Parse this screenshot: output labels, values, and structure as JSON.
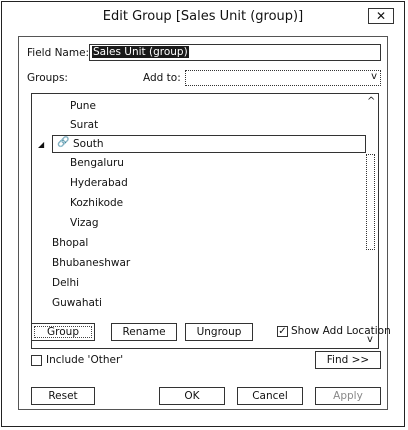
{
  "window": {
    "title": "Edit Group [Sales Unit (group)]",
    "close_glyph": "✕"
  },
  "form": {
    "field_name_label": "Field Name:",
    "field_name_value": "Sales Unit (group)",
    "groups_label": "Groups:",
    "add_to_label": "Add to:",
    "add_to_value": ""
  },
  "tree": {
    "items": [
      {
        "label": "Pune"
      },
      {
        "label": "Surat"
      },
      {
        "label": "South"
      },
      {
        "label": "Bengaluru"
      },
      {
        "label": "Hyderabad"
      },
      {
        "label": "Kozhikode"
      },
      {
        "label": "Vizag"
      },
      {
        "label": "Bhopal"
      },
      {
        "label": "Bhubaneshwar"
      },
      {
        "label": "Delhi"
      },
      {
        "label": "Guwahati"
      }
    ],
    "expanded_glyph": "◢",
    "group_icon_glyph": "🔗",
    "scroll_up_glyph": "^",
    "scroll_down_glyph": "v"
  },
  "buttons": {
    "group": "Group",
    "rename": "Rename",
    "ungroup": "Ungroup",
    "show_add_location": "Show Add Location",
    "include_other": "Include 'Other'",
    "find": "Find >>",
    "reset": "Reset",
    "ok": "OK",
    "cancel": "Cancel",
    "apply": "Apply"
  },
  "state": {
    "show_add_location_checked": true,
    "include_other_checked": false,
    "check_glyph": "✓",
    "dropdown_glyph": "v"
  }
}
